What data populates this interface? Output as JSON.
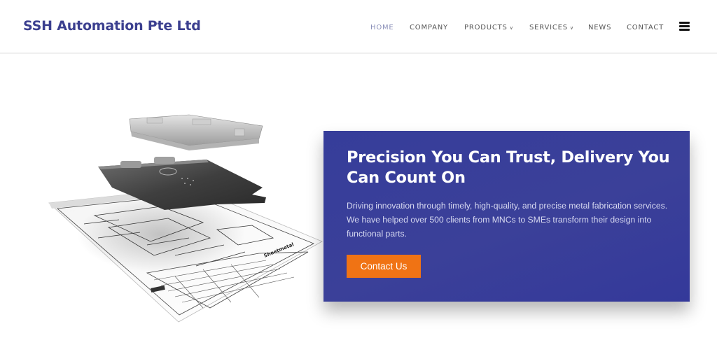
{
  "header": {
    "brand": "SSH Automation Pte Ltd",
    "nav": [
      {
        "label": "HOME",
        "active": true,
        "has_dropdown": false
      },
      {
        "label": "COMPANY",
        "active": false,
        "has_dropdown": false
      },
      {
        "label": "PRODUCTS",
        "active": false,
        "has_dropdown": true
      },
      {
        "label": "SERVICES",
        "active": false,
        "has_dropdown": true
      },
      {
        "label": "NEWS",
        "active": false,
        "has_dropdown": false
      },
      {
        "label": "CONTACT",
        "active": false,
        "has_dropdown": false
      }
    ],
    "dropdown_icon": "chevron-down-icon",
    "menu_icon": "hamburger-menu-icon"
  },
  "hero": {
    "illustration": "exploded sheet metal parts over technical drawing",
    "drawing_title_label": "Sheetmetal",
    "title": "Precision You Can Trust, Delivery You Can Count On",
    "description": "Driving innovation through timely, high-quality, and precise metal fabrication services. We have helped over 500 clients from MNCs to SMEs transform their design into functional parts.",
    "cta_label": "Contact Us"
  },
  "colors": {
    "brand": "#3b3f8f",
    "card_background": "#383e9a",
    "cta": "#f07314",
    "nav_active": "#8a8fb8",
    "nav_text": "#555555"
  }
}
